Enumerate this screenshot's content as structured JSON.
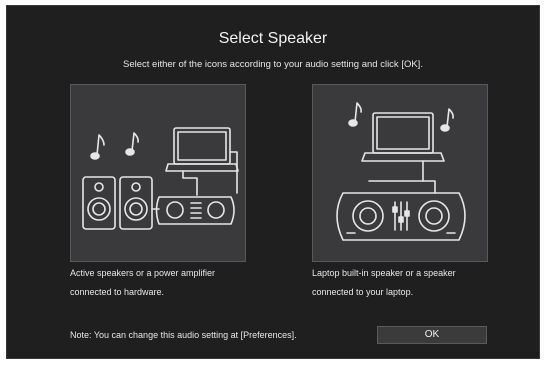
{
  "dialog": {
    "title": "Select Speaker",
    "subtitle": "Select either of the icons according to your audio setting and click [OK].",
    "options": [
      {
        "icon": "active-speakers-with-controller-icon",
        "line1": "Active speakers or a power amplifier",
        "line2": "connected to hardware."
      },
      {
        "icon": "laptop-speaker-with-controller-icon",
        "line1": "Laptop built-in speaker or a speaker",
        "line2": "connected to your laptop."
      }
    ],
    "note": "Note: You can change this audio setting at [Preferences].",
    "ok_label": "OK"
  },
  "colors": {
    "background": "#1f1f1f",
    "panel": "#3a3a3c",
    "line": "#e6e6e6"
  }
}
